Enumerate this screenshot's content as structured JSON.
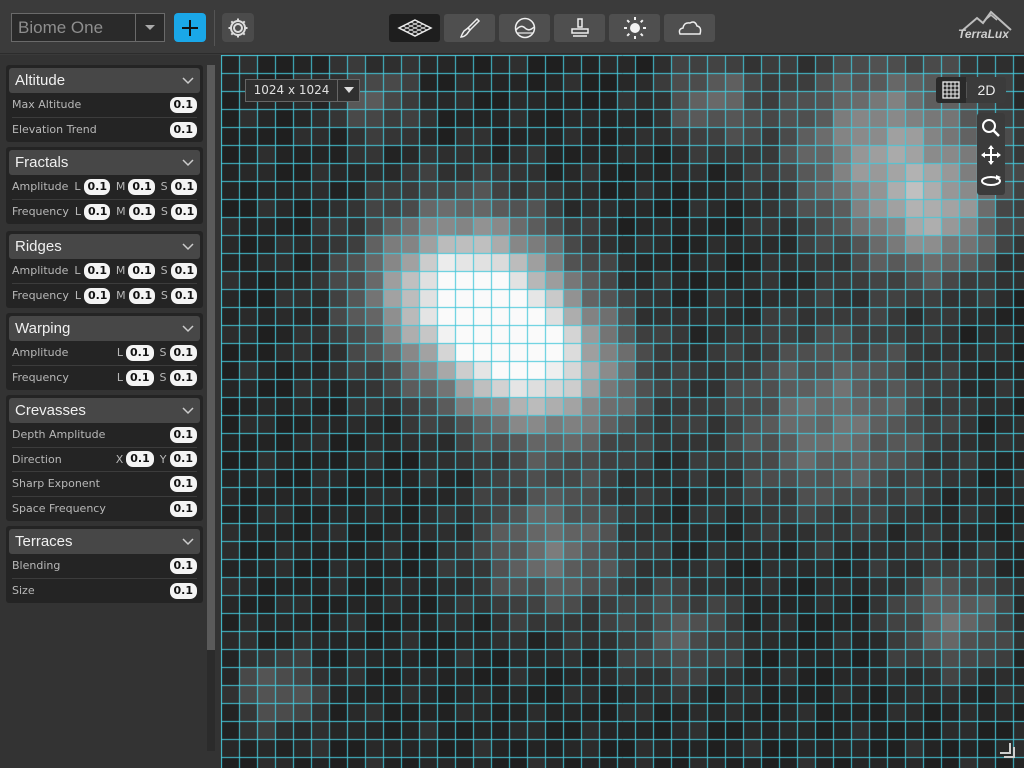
{
  "header": {
    "biome_value": "Biome One",
    "logo_text": "TerraLux",
    "tools": [
      {
        "icon": "terrain-plane-icon",
        "active": true
      },
      {
        "icon": "paint-brush-icon",
        "active": false
      },
      {
        "icon": "landscape-view-icon",
        "active": false
      },
      {
        "icon": "stamp-icon",
        "active": false
      },
      {
        "icon": "sun-icon",
        "active": false
      },
      {
        "icon": "cloud-icon",
        "active": false
      }
    ]
  },
  "viewport": {
    "resolution": "1024 x 1024",
    "mode": "2D"
  },
  "panels": [
    {
      "title": "Altitude",
      "rows": [
        {
          "label": "Max Altitude",
          "values": [
            {
              "sub": "",
              "val": "0.1"
            }
          ]
        },
        {
          "label": "Elevation Trend",
          "values": [
            {
              "sub": "",
              "val": "0.1"
            }
          ]
        }
      ]
    },
    {
      "title": "Fractals",
      "rows": [
        {
          "label": "Amplitude",
          "values": [
            {
              "sub": "L",
              "val": "0.1"
            },
            {
              "sub": "M",
              "val": "0.1"
            },
            {
              "sub": "S",
              "val": "0.1"
            }
          ]
        },
        {
          "label": "Frequency",
          "values": [
            {
              "sub": "L",
              "val": "0.1"
            },
            {
              "sub": "M",
              "val": "0.1"
            },
            {
              "sub": "S",
              "val": "0.1"
            }
          ]
        }
      ]
    },
    {
      "title": "Ridges",
      "rows": [
        {
          "label": "Amplitude",
          "values": [
            {
              "sub": "L",
              "val": "0.1"
            },
            {
              "sub": "M",
              "val": "0.1"
            },
            {
              "sub": "S",
              "val": "0.1"
            }
          ]
        },
        {
          "label": "Frequency",
          "values": [
            {
              "sub": "L",
              "val": "0.1"
            },
            {
              "sub": "M",
              "val": "0.1"
            },
            {
              "sub": "S",
              "val": "0.1"
            }
          ]
        }
      ]
    },
    {
      "title": "Warping",
      "rows": [
        {
          "label": "Amplitude",
          "values": [
            {
              "sub": "L",
              "val": "0.1"
            },
            {
              "sub": "S",
              "val": "0.1"
            }
          ]
        },
        {
          "label": "Frequency",
          "values": [
            {
              "sub": "L",
              "val": "0.1"
            },
            {
              "sub": "S",
              "val": "0.1"
            }
          ]
        }
      ]
    },
    {
      "title": "Crevasses",
      "rows": [
        {
          "label": "Depth Amplitude",
          "values": [
            {
              "sub": "",
              "val": "0.1"
            }
          ]
        },
        {
          "label": "Direction",
          "values": [
            {
              "sub": "X",
              "val": "0.1"
            },
            {
              "sub": "Y",
              "val": "0.1"
            }
          ]
        },
        {
          "label": "Sharp Exponent",
          "values": [
            {
              "sub": "",
              "val": "0.1"
            }
          ]
        },
        {
          "label": "Space Frequency",
          "values": [
            {
              "sub": "",
              "val": "0.1"
            }
          ]
        }
      ]
    },
    {
      "title": "Terraces",
      "rows": [
        {
          "label": "Blending",
          "values": [
            {
              "sub": "",
              "val": "0.1"
            }
          ]
        },
        {
          "label": "Size",
          "values": [
            {
              "sub": "",
              "val": "0.1"
            }
          ]
        }
      ]
    }
  ],
  "colors": {
    "accent": "#1aa7e8",
    "grid_line": "#46c8da",
    "panel_bg": "#242424",
    "value_pill": "#f4f4f4"
  }
}
